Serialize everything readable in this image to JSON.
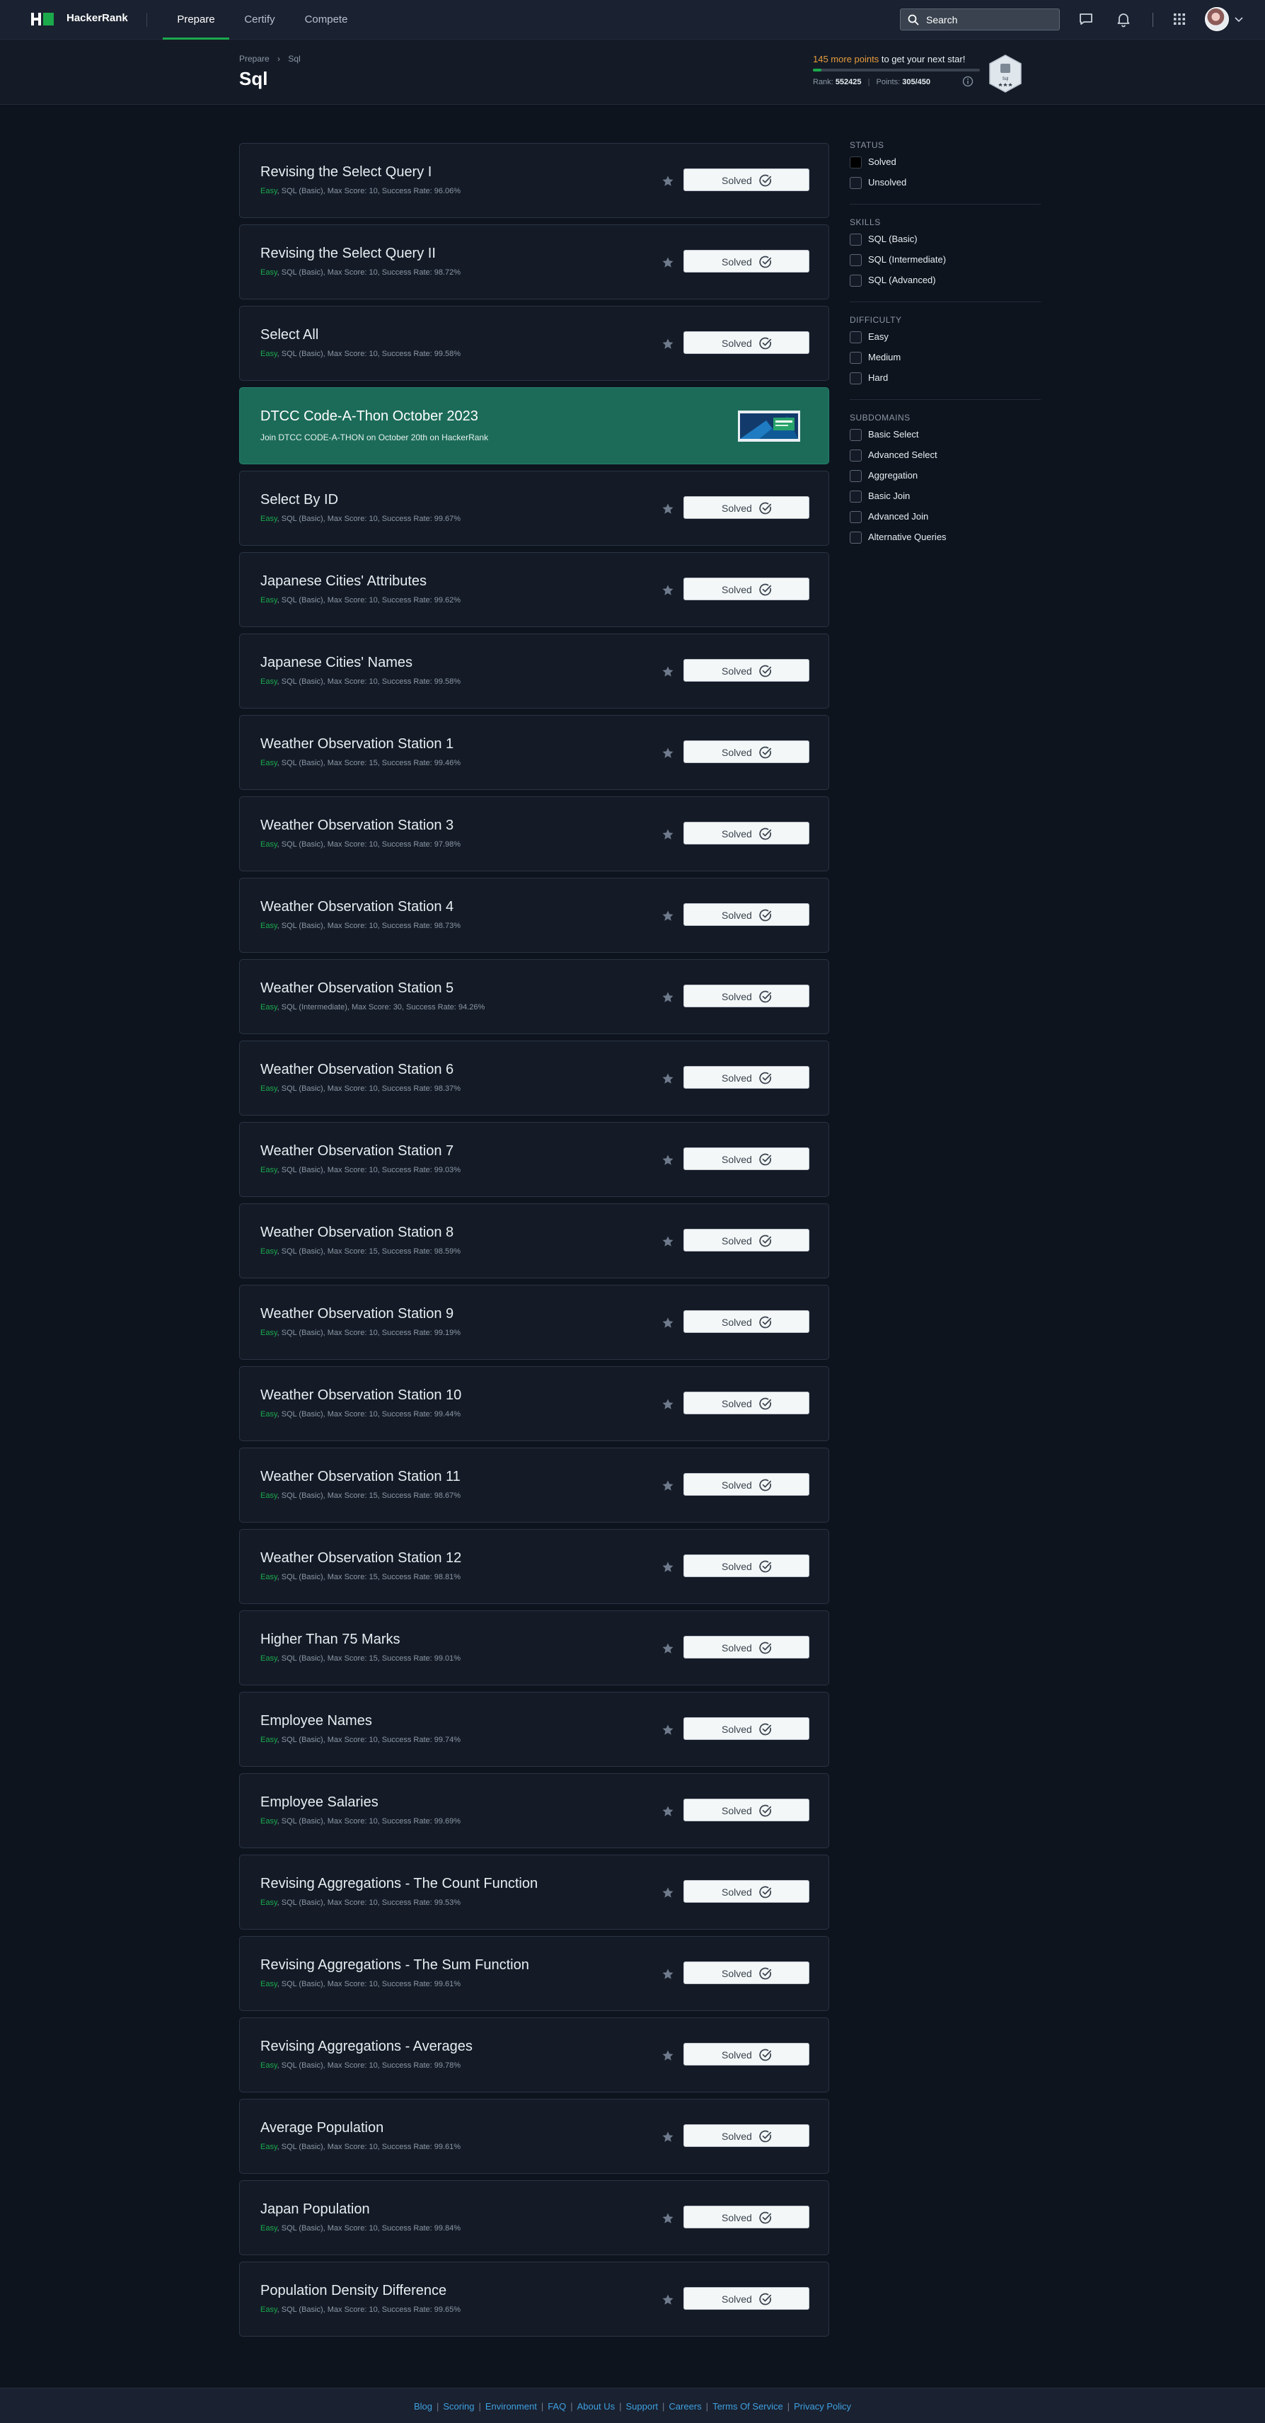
{
  "nav": {
    "brand": "HackerRank",
    "tabs": [
      {
        "label": "Prepare",
        "active": true
      },
      {
        "label": "Certify",
        "active": false
      },
      {
        "label": "Compete",
        "active": false
      }
    ],
    "search_placeholder": "Search",
    "icons": [
      "search-icon",
      "chat-icon",
      "bell-icon",
      "apps-grid-icon",
      "chevron-down-icon"
    ]
  },
  "header": {
    "breadcrumb": [
      "Prepare",
      "Sql"
    ],
    "title": "Sql",
    "next_star_points": "145 more points",
    "next_star_suffix": " to get your next star!",
    "progress": 0.05,
    "rank_label": "Rank:",
    "rank_value": "552425",
    "points_label": "Points:",
    "points_value": "305/450",
    "badge_label": "Sql",
    "badge_stars": 3
  },
  "challenges": [
    {
      "title": "Revising the Select Query I",
      "difficulty": "Easy",
      "meta": "SQL (Basic), Max Score: 10, Success Rate: 96.06%",
      "status": "Solved"
    },
    {
      "title": "Revising the Select Query II",
      "difficulty": "Easy",
      "meta": "SQL (Basic), Max Score: 10, Success Rate: 98.72%",
      "status": "Solved"
    },
    {
      "title": "Select All",
      "difficulty": "Easy",
      "meta": "SQL (Basic), Max Score: 10, Success Rate: 99.58%",
      "status": "Solved"
    },
    {
      "promo": true,
      "title": "DTCC Code-A-Thon October 2023",
      "subtitle": "Join DTCC CODE-A-THON on October 20th on HackerRank"
    },
    {
      "title": "Select By ID",
      "difficulty": "Easy",
      "meta": "SQL (Basic), Max Score: 10, Success Rate: 99.67%",
      "status": "Solved"
    },
    {
      "title": "Japanese Cities' Attributes",
      "difficulty": "Easy",
      "meta": "SQL (Basic), Max Score: 10, Success Rate: 99.62%",
      "status": "Solved"
    },
    {
      "title": "Japanese Cities' Names",
      "difficulty": "Easy",
      "meta": "SQL (Basic), Max Score: 10, Success Rate: 99.58%",
      "status": "Solved"
    },
    {
      "title": "Weather Observation Station 1",
      "difficulty": "Easy",
      "meta": "SQL (Basic), Max Score: 15, Success Rate: 99.46%",
      "status": "Solved"
    },
    {
      "title": "Weather Observation Station 3",
      "difficulty": "Easy",
      "meta": "SQL (Basic), Max Score: 10, Success Rate: 97.98%",
      "status": "Solved"
    },
    {
      "title": "Weather Observation Station 4",
      "difficulty": "Easy",
      "meta": "SQL (Basic), Max Score: 10, Success Rate: 98.73%",
      "status": "Solved"
    },
    {
      "title": "Weather Observation Station 5",
      "difficulty": "Easy",
      "meta": "SQL (Intermediate), Max Score: 30, Success Rate: 94.26%",
      "status": "Solved"
    },
    {
      "title": "Weather Observation Station 6",
      "difficulty": "Easy",
      "meta": "SQL (Basic), Max Score: 10, Success Rate: 98.37%",
      "status": "Solved"
    },
    {
      "title": "Weather Observation Station 7",
      "difficulty": "Easy",
      "meta": "SQL (Basic), Max Score: 10, Success Rate: 99.03%",
      "status": "Solved"
    },
    {
      "title": "Weather Observation Station 8",
      "difficulty": "Easy",
      "meta": "SQL (Basic), Max Score: 15, Success Rate: 98.59%",
      "status": "Solved"
    },
    {
      "title": "Weather Observation Station 9",
      "difficulty": "Easy",
      "meta": "SQL (Basic), Max Score: 10, Success Rate: 99.19%",
      "status": "Solved"
    },
    {
      "title": "Weather Observation Station 10",
      "difficulty": "Easy",
      "meta": "SQL (Basic), Max Score: 10, Success Rate: 99.44%",
      "status": "Solved"
    },
    {
      "title": "Weather Observation Station 11",
      "difficulty": "Easy",
      "meta": "SQL (Basic), Max Score: 15, Success Rate: 98.67%",
      "status": "Solved"
    },
    {
      "title": "Weather Observation Station 12",
      "difficulty": "Easy",
      "meta": "SQL (Basic), Max Score: 15, Success Rate: 98.81%",
      "status": "Solved"
    },
    {
      "title": "Higher Than 75 Marks",
      "difficulty": "Easy",
      "meta": "SQL (Basic), Max Score: 15, Success Rate: 99.01%",
      "status": "Solved"
    },
    {
      "title": "Employee Names",
      "difficulty": "Easy",
      "meta": "SQL (Basic), Max Score: 10, Success Rate: 99.74%",
      "status": "Solved"
    },
    {
      "title": "Employee Salaries",
      "difficulty": "Easy",
      "meta": "SQL (Basic), Max Score: 10, Success Rate: 99.69%",
      "status": "Solved"
    },
    {
      "title": "Revising Aggregations - The Count Function",
      "difficulty": "Easy",
      "meta": "SQL (Basic), Max Score: 10, Success Rate: 99.53%",
      "status": "Solved"
    },
    {
      "title": "Revising Aggregations - The Sum Function",
      "difficulty": "Easy",
      "meta": "SQL (Basic), Max Score: 10, Success Rate: 99.61%",
      "status": "Solved"
    },
    {
      "title": "Revising Aggregations - Averages",
      "difficulty": "Easy",
      "meta": "SQL (Basic), Max Score: 10, Success Rate: 99.78%",
      "status": "Solved"
    },
    {
      "title": "Average Population",
      "difficulty": "Easy",
      "meta": "SQL (Basic), Max Score: 10, Success Rate: 99.61%",
      "status": "Solved"
    },
    {
      "title": "Japan Population",
      "difficulty": "Easy",
      "meta": "SQL (Basic), Max Score: 10, Success Rate: 99.84%",
      "status": "Solved"
    },
    {
      "title": "Population Density Difference",
      "difficulty": "Easy",
      "meta": "SQL (Basic), Max Score: 10, Success Rate: 99.65%",
      "status": "Solved"
    }
  ],
  "filters": [
    {
      "heading": "STATUS",
      "options": [
        {
          "label": "Solved",
          "checked": true
        },
        {
          "label": "Unsolved",
          "checked": false
        }
      ]
    },
    {
      "heading": "SKILLS",
      "options": [
        {
          "label": "SQL (Basic)",
          "checked": false
        },
        {
          "label": "SQL (Intermediate)",
          "checked": false
        },
        {
          "label": "SQL (Advanced)",
          "checked": false
        }
      ]
    },
    {
      "heading": "DIFFICULTY",
      "options": [
        {
          "label": "Easy",
          "checked": false
        },
        {
          "label": "Medium",
          "checked": false
        },
        {
          "label": "Hard",
          "checked": false
        }
      ]
    },
    {
      "heading": "SUBDOMAINS",
      "options": [
        {
          "label": "Basic Select",
          "checked": false
        },
        {
          "label": "Advanced Select",
          "checked": false
        },
        {
          "label": "Aggregation",
          "checked": false
        },
        {
          "label": "Basic Join",
          "checked": false
        },
        {
          "label": "Advanced Join",
          "checked": false
        },
        {
          "label": "Alternative Queries",
          "checked": false
        }
      ]
    }
  ],
  "footer": {
    "links": [
      "Blog",
      "Scoring",
      "Environment",
      "FAQ",
      "About Us",
      "Support",
      "Careers",
      "Terms Of Service",
      "Privacy Policy"
    ]
  },
  "colors": {
    "background": "#0e141e",
    "card": "#141b27",
    "accent_green": "#1ba94c",
    "promo_green": "#1c6b59",
    "points_orange": "#e89b3b",
    "link_blue": "#3ea0e0"
  }
}
